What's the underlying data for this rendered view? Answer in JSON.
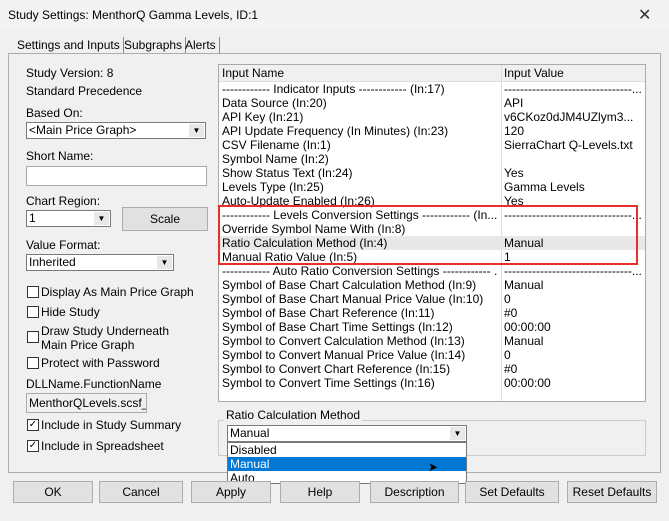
{
  "window": {
    "title": "Study Settings: MenthorQ Gamma Levels, ID:1",
    "close": "✕"
  },
  "tabs": [
    "Settings and Inputs",
    "Subgraphs",
    "Alerts"
  ],
  "left": {
    "study_version": "Study Version: 8",
    "precedence": "Standard Precedence",
    "based_on_label": "Based On:",
    "based_on_value": "<Main Price Graph>",
    "short_name_label": "Short Name:",
    "short_name_value": "",
    "chart_region_label": "Chart Region:",
    "chart_region_value": "1",
    "scale_label": "Scale",
    "value_format_label": "Value Format:",
    "value_format_value": "Inherited",
    "checkboxes": [
      {
        "label": "Display As Main Price Graph",
        "checked": false
      },
      {
        "label": "Hide Study",
        "checked": false
      },
      {
        "label": "Draw Study Underneath Main Price Graph",
        "checked": false
      },
      {
        "label": "Protect with Password",
        "checked": false
      }
    ],
    "dll_label": "DLLName.FunctionName",
    "dll_value": "MenthorQLevels.scsf_",
    "checkboxes2": [
      {
        "label": "Include in Study Summary",
        "checked": true
      },
      {
        "label": "Include in Spreadsheet",
        "checked": true
      }
    ]
  },
  "table": {
    "headers": [
      "Input Name",
      "Input Value"
    ],
    "rows": [
      {
        "name": "------------ Indicator Inputs ------------   (In:17)",
        "value": "--------------------------------..."
      },
      {
        "name": "Data Source   (In:20)",
        "value": "API"
      },
      {
        "name": "API Key   (In:21)",
        "value": "v6CKoz0dJM4UZlym3..."
      },
      {
        "name": "API Update Frequency (In Minutes)   (In:23)",
        "value": "120"
      },
      {
        "name": "CSV Filename   (In:1)",
        "value": "SierraChart Q-Levels.txt"
      },
      {
        "name": "Symbol Name   (In:2)",
        "value": ""
      },
      {
        "name": "Show Status Text   (In:24)",
        "value": "Yes"
      },
      {
        "name": "Levels Type   (In:25)",
        "value": "Gamma Levels"
      },
      {
        "name": "Auto-Update Enabled   (In:26)",
        "value": "Yes"
      },
      {
        "name": "------------ Levels Conversion Settings ------------   (In...",
        "value": "--------------------------------..."
      },
      {
        "name": "Override Symbol Name With   (In:8)",
        "value": ""
      },
      {
        "name": "Ratio Calculation Method   (In:4)",
        "value": "Manual",
        "selected": true
      },
      {
        "name": "Manual Ratio Value   (In:5)",
        "value": "1"
      },
      {
        "name": "------------ Auto Ratio Conversion Settings ------------ ...",
        "value": "--------------------------------..."
      },
      {
        "name": "Symbol of Base Chart Calculation Method   (In:9)",
        "value": "Manual"
      },
      {
        "name": "Symbol of Base Chart Manual Price Value   (In:10)",
        "value": "0"
      },
      {
        "name": "Symbol of Base Chart Reference   (In:11)",
        "value": "#0"
      },
      {
        "name": "Symbol of Base Chart Time Settings   (In:12)",
        "value": "00:00:00"
      },
      {
        "name": "Symbol to Convert Calculation Method   (In:13)",
        "value": "Manual"
      },
      {
        "name": "Symbol to Convert Manual Price Value   (In:14)",
        "value": "0"
      },
      {
        "name": "Symbol to Convert Chart Reference   (In:15)",
        "value": "#0"
      },
      {
        "name": "Symbol to Convert Time Settings   (In:16)",
        "value": "00:00:00"
      }
    ],
    "highlight_color": "#e8302a"
  },
  "editor": {
    "label": "Ratio Calculation Method",
    "value": "Manual",
    "options": [
      "Disabled",
      "Manual",
      "Auto"
    ],
    "highlighted_option": "Manual"
  },
  "buttons": [
    "OK",
    "Cancel",
    "Apply",
    "Help",
    "Description",
    "Set Defaults",
    "Reset Defaults"
  ]
}
